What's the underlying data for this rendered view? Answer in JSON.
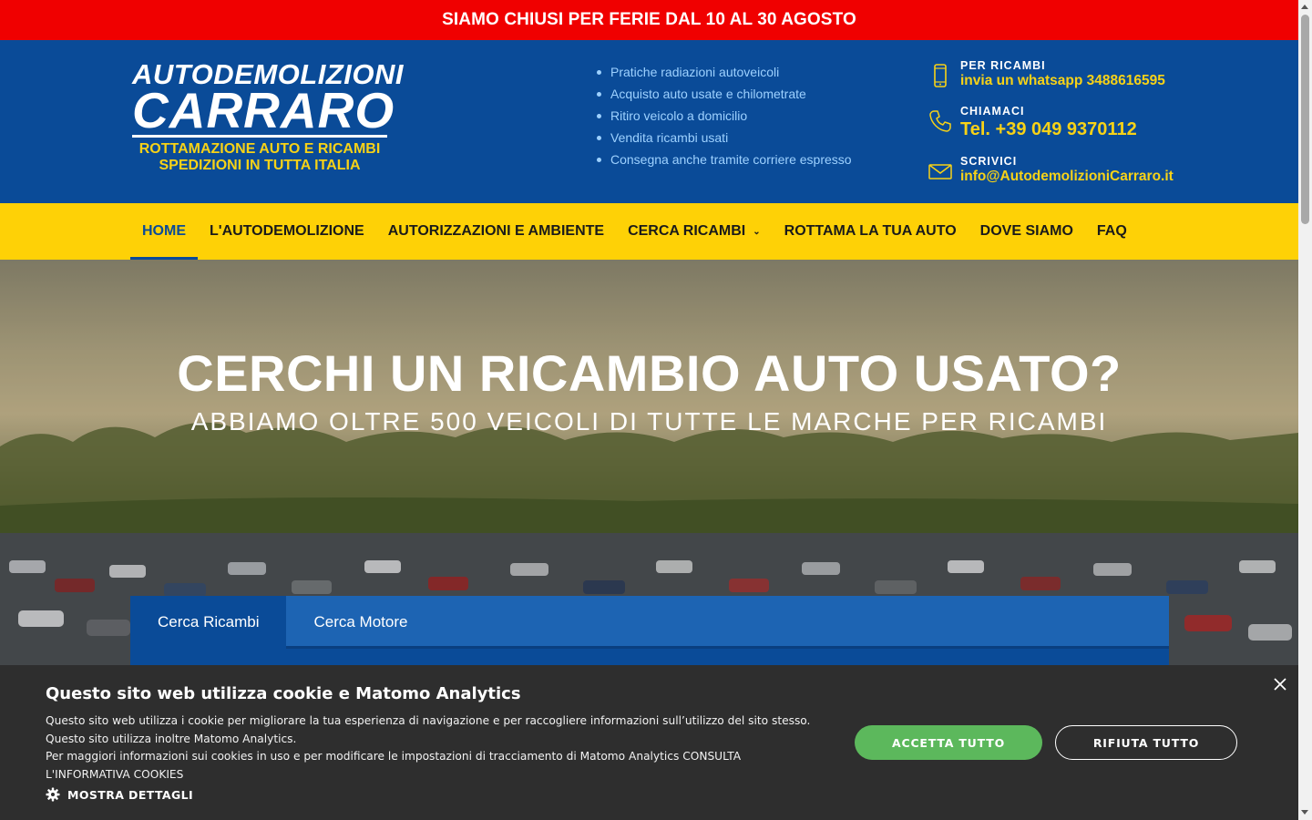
{
  "announcement": "SIAMO CHIUSI PER FERIE DAL 10 AL 30 AGOSTO",
  "logo": {
    "line1": "AUTODEMOLIZIONI",
    "line2": "CARRARO",
    "line3": "ROTTAMAZIONE AUTO E RICAMBI",
    "line4": "SPEDIZIONI IN TUTTA ITALIA"
  },
  "services": [
    "Pratiche radiazioni autoveicoli",
    "Acquisto auto usate e chilometrate",
    "Ritiro veicolo a domicilio",
    "Vendita ricambi usati",
    "Consegna anche tramite corriere espresso"
  ],
  "contacts": {
    "ricambi": {
      "label": "PER RICAMBI",
      "value": "invia un whatsapp 3488616595",
      "icon": "smartphone-icon"
    },
    "phone": {
      "label": "CHIAMACI",
      "value": "Tel. +39 049 9370112",
      "icon": "phone-icon"
    },
    "email": {
      "label": "SCRIVICI",
      "value": "info@AutodemolizioniCarraro.it",
      "icon": "envelope-icon"
    }
  },
  "nav": {
    "home": "HOME",
    "autodemolizione": "L'AUTODEMOLIZIONE",
    "autorizzazioni": "AUTORIZZAZIONI E AMBIENTE",
    "cerca_ricambi": "CERCA RICAMBI",
    "rottama": "ROTTAMA LA TUA AUTO",
    "dove_siamo": "DOVE SIAMO",
    "faq": "FAQ"
  },
  "hero": {
    "title": "CERCHI UN RICAMBIO AUTO USATO?",
    "subtitle": "ABBIAMO OLTRE 500 VEICOLI DI TUTTE LE MARCHE PER RICAMBI"
  },
  "search_tabs": {
    "ricambi": "Cerca Ricambi",
    "motore": "Cerca Motore"
  },
  "cookie": {
    "title": "Questo sito web utilizza cookie e Matomo Analytics",
    "text1": "Questo sito web utilizza i cookie per migliorare la tua esperienza di navigazione e per raccogliere informazioni sull’utilizzo del sito stesso. Questo sito utilizza inoltre Matomo Analytics.",
    "text2": "Per maggiori informazioni sui cookies in uso e per modificare le impostazioni di tracciamento di Matomo Analytics CONSULTA L'INFORMATIVA COOKIES",
    "details": "MOSTRA DETTAGLI",
    "accept": "ACCETTA TUTTO",
    "reject": "RIFIUTA TUTTO"
  },
  "colors": {
    "announcement_bg": "#f00000",
    "header_bg": "#0a4b98",
    "accent_yellow": "#f7d217",
    "nav_bg": "#fed106",
    "cookie_bg": "#2e2e2e",
    "accept_green": "#5cb85c"
  }
}
